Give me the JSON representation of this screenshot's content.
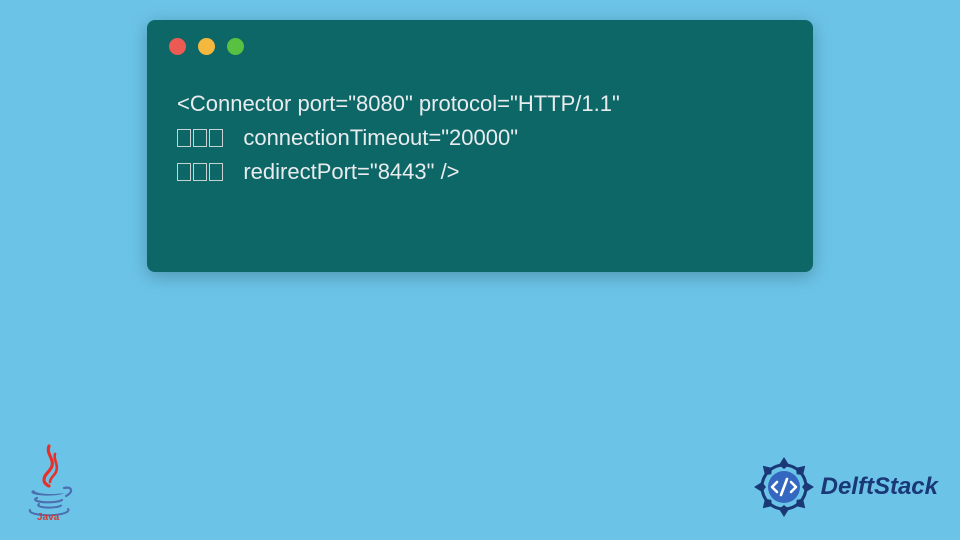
{
  "code_window": {
    "controls": {
      "red": "#eb5b53",
      "yellow": "#f4b83e",
      "green": "#58c141"
    },
    "lines": [
      "<Connector port=\"8080\" protocol=\"HTTP/1.1\"",
      "   connectionTimeout=\"20000\"",
      "   redirectPort=\"8443\" />"
    ]
  },
  "footer": {
    "java_label": "Java",
    "delft_label": "DelftStack"
  },
  "colors": {
    "window_bg": "#0e6767",
    "page_bg": "#6bc4e8",
    "delft_blue": "#1a3876"
  }
}
